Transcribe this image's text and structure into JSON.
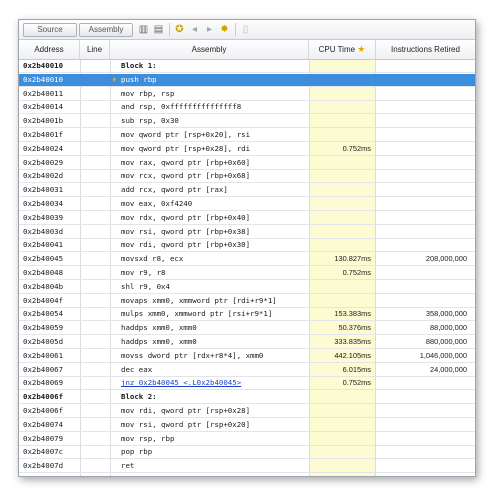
{
  "toolbar": {
    "source_label": "Source",
    "assembly_label": "Assembly"
  },
  "columns": {
    "address": "Address",
    "line": "Line",
    "assembly": "Assembly",
    "cpu_time": "CPU Time",
    "instructions": "Instructions Retired"
  },
  "rows": [
    {
      "address": "0x2b40010",
      "assembly": "Block 1:",
      "cpu": "",
      "inst": "",
      "bold": true
    },
    {
      "address": "0x2b40010",
      "assembly": "push rbp",
      "cpu": "",
      "inst": "",
      "selected": true
    },
    {
      "address": "0x2b40011",
      "assembly": "mov rbp, rsp",
      "cpu": "",
      "inst": ""
    },
    {
      "address": "0x2b40014",
      "assembly": "and rsp, 0xfffffffffffffff8",
      "cpu": "",
      "inst": ""
    },
    {
      "address": "0x2b4001b",
      "assembly": "sub rsp, 0x30",
      "cpu": "",
      "inst": ""
    },
    {
      "address": "0x2b4001f",
      "assembly": "mov qword ptr [rsp+0x20], rsi",
      "cpu": "",
      "inst": ""
    },
    {
      "address": "0x2b40024",
      "assembly": "mov qword ptr [rsp+0x28], rdi",
      "cpu": "0.752ms",
      "inst": ""
    },
    {
      "address": "0x2b40029",
      "assembly": "mov rax, qword ptr [rbp+0x60]",
      "cpu": "",
      "inst": ""
    },
    {
      "address": "0x2b4002d",
      "assembly": "mov rcx, qword ptr [rbp+0x68]",
      "cpu": "",
      "inst": ""
    },
    {
      "address": "0x2b40031",
      "assembly": "add rcx, qword ptr [rax]",
      "cpu": "",
      "inst": ""
    },
    {
      "address": "0x2b40034",
      "assembly": "mov eax, 0xf4240",
      "cpu": "",
      "inst": ""
    },
    {
      "address": "0x2b40039",
      "assembly": "mov rdx, qword ptr [rbp+0x40]",
      "cpu": "",
      "inst": ""
    },
    {
      "address": "0x2b4003d",
      "assembly": "mov rsi, qword ptr [rbp+0x38]",
      "cpu": "",
      "inst": ""
    },
    {
      "address": "0x2b40041",
      "assembly": "mov rdi, qword ptr [rbp+0x30]",
      "cpu": "",
      "inst": ""
    },
    {
      "address": "0x2b40045",
      "assembly": "movsxd r8, ecx",
      "cpu": "130.827ms",
      "inst": "208,000,000"
    },
    {
      "address": "0x2b40048",
      "assembly": "mov r9, r8",
      "cpu": "0.752ms",
      "inst": ""
    },
    {
      "address": "0x2b4004b",
      "assembly": "shl r9, 0x4",
      "cpu": "",
      "inst": ""
    },
    {
      "address": "0x2b4004f",
      "assembly": "movaps xmm0, xmmword ptr [rdi+r9*1]",
      "cpu": "",
      "inst": ""
    },
    {
      "address": "0x2b40054",
      "assembly": "mulps xmm0, xmmword ptr [rsi+r9*1]",
      "cpu": "153.383ms",
      "inst": "358,000,000"
    },
    {
      "address": "0x2b40059",
      "assembly": "haddps xmm0, xmm0",
      "cpu": "50.376ms",
      "inst": "88,000,000"
    },
    {
      "address": "0x2b4005d",
      "assembly": "haddps xmm0, xmm0",
      "cpu": "333.835ms",
      "inst": "880,000,000"
    },
    {
      "address": "0x2b40061",
      "assembly": "movss dword ptr [rdx+r8*4], xmm0",
      "cpu": "442.105ms",
      "inst": "1,046,000,000"
    },
    {
      "address": "0x2b40067",
      "assembly": "dec eax",
      "cpu": "6.015ms",
      "inst": "24,000,000"
    },
    {
      "address": "0x2b40069",
      "assembly": "jnz 0x2b40045 <.L0x2b40045>",
      "cpu": "0.752ms",
      "inst": "",
      "link": true
    },
    {
      "address": "0x2b4006f",
      "assembly": "Block 2:",
      "cpu": "",
      "inst": "",
      "bold": true
    },
    {
      "address": "0x2b4006f",
      "assembly": "mov rdi, qword ptr [rsp+0x28]",
      "cpu": "",
      "inst": ""
    },
    {
      "address": "0x2b40074",
      "assembly": "mov rsi, qword ptr [rsp+0x20]",
      "cpu": "",
      "inst": ""
    },
    {
      "address": "0x2b40079",
      "assembly": "mov rsp, rbp",
      "cpu": "",
      "inst": ""
    },
    {
      "address": "0x2b4007c",
      "assembly": "pop rbp",
      "cpu": "",
      "inst": ""
    },
    {
      "address": "0x2b4007d",
      "assembly": "ret",
      "cpu": "",
      "inst": ""
    }
  ],
  "colors": {
    "selection": "#3d8ddd",
    "cpu_column": "#fdfbd2",
    "link": "#1a3fc8"
  }
}
